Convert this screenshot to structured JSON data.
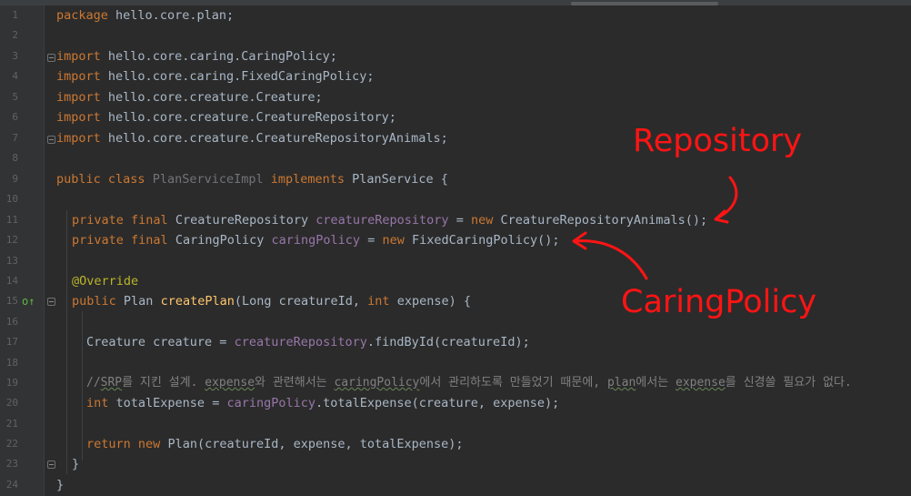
{
  "editor": {
    "line_numbers": [
      "1",
      "2",
      "3",
      "4",
      "5",
      "6",
      "7",
      "8",
      "9",
      "10",
      "11",
      "12",
      "13",
      "14",
      "15",
      "16",
      "17",
      "18",
      "19",
      "20",
      "21",
      "22",
      "23",
      "24"
    ],
    "package": {
      "kw": "package",
      "name": "hello.core.plan;"
    },
    "imports": [
      {
        "kw": "import",
        "name": "hello.core.caring.CaringPolicy;"
      },
      {
        "kw": "import",
        "name": "hello.core.caring.FixedCaringPolicy;"
      },
      {
        "kw": "import",
        "name": "hello.core.creature.Creature;"
      },
      {
        "kw": "import",
        "name": "hello.core.creature.CreatureRepository;"
      },
      {
        "kw": "import",
        "name": "hello.core.creature.CreatureRepositoryAnimals;"
      }
    ],
    "class_decl": {
      "mods": "public class",
      "name": "PlanServiceImpl",
      "impl": "implements",
      "iface": "PlanService {"
    },
    "field1": {
      "mods": "private final",
      "type": "CreatureRepository",
      "name": "creatureRepository",
      "eq": "=",
      "new": "new",
      "init": "CreatureRepositoryAnimals();"
    },
    "field2": {
      "mods": "private final",
      "type": "CaringPolicy",
      "name": "caringPolicy",
      "eq": "=",
      "new": "new",
      "init": "FixedCaringPolicy();"
    },
    "annotation": "@Override",
    "method": {
      "mods": "public",
      "ret": "Plan",
      "name": "createPlan",
      "p1": "(Long creatureId,",
      "int": "int",
      "p2": "expense) {"
    },
    "stmt1": {
      "decl": "Creature creature =",
      "field": "creatureRepository",
      "rest": ".findById(creatureId);"
    },
    "comment": {
      "t1": "//",
      "t2": "SRP",
      "t3": "를 지킨 설계. ",
      "t4": "expense",
      "t5": "와 관련해서는 ",
      "t6": "caringPolicy",
      "t7": "에서 관리하도록 만들었기 때문에, ",
      "t8": "plan",
      "t9": "에서는 ",
      "t10": "expense",
      "t11": "를 신경쓸 필요가 없다."
    },
    "stmt2": {
      "kw": "int",
      "decl": "totalExpense =",
      "field": "caringPolicy",
      "rest": ".totalExpense(creature, expense);"
    },
    "ret_stmt": {
      "kw1": "return",
      "kw2": "new",
      "rest": "Plan(creatureId, expense, totalExpense);"
    },
    "close_method": "}",
    "close_class": "}",
    "run_icon": "run-gutter-icon"
  },
  "annotations": {
    "repository_label": "Repository",
    "caring_label": "CaringPolicy",
    "color": "#ff1414"
  }
}
